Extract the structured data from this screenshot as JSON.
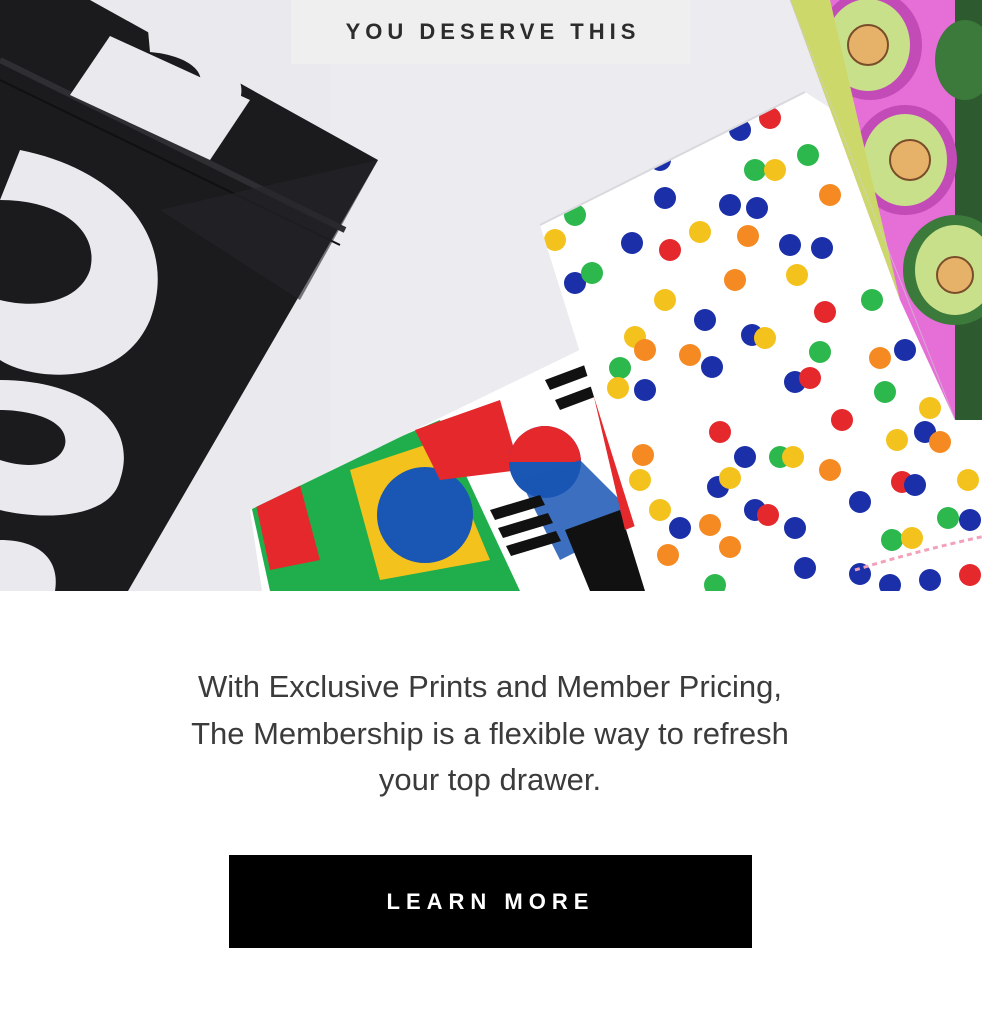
{
  "hero": {
    "eyebrow": "YOU DESERVE THIS",
    "image_alt": "Black MeUndies pouch with colorful printed underwear in polka dot, flag and avocado prints"
  },
  "content": {
    "body_text": "With Exclusive Prints and Member Pricing, The Membership is a flexible way to refresh your top drawer."
  },
  "cta": {
    "label": "LEARN MORE"
  },
  "colors": {
    "cta_background": "#000000",
    "cta_text": "#ffffff",
    "eyebrow_background": "#efefef",
    "body_text": "#3b3b3b",
    "hero_background": "#e9e9ee"
  }
}
